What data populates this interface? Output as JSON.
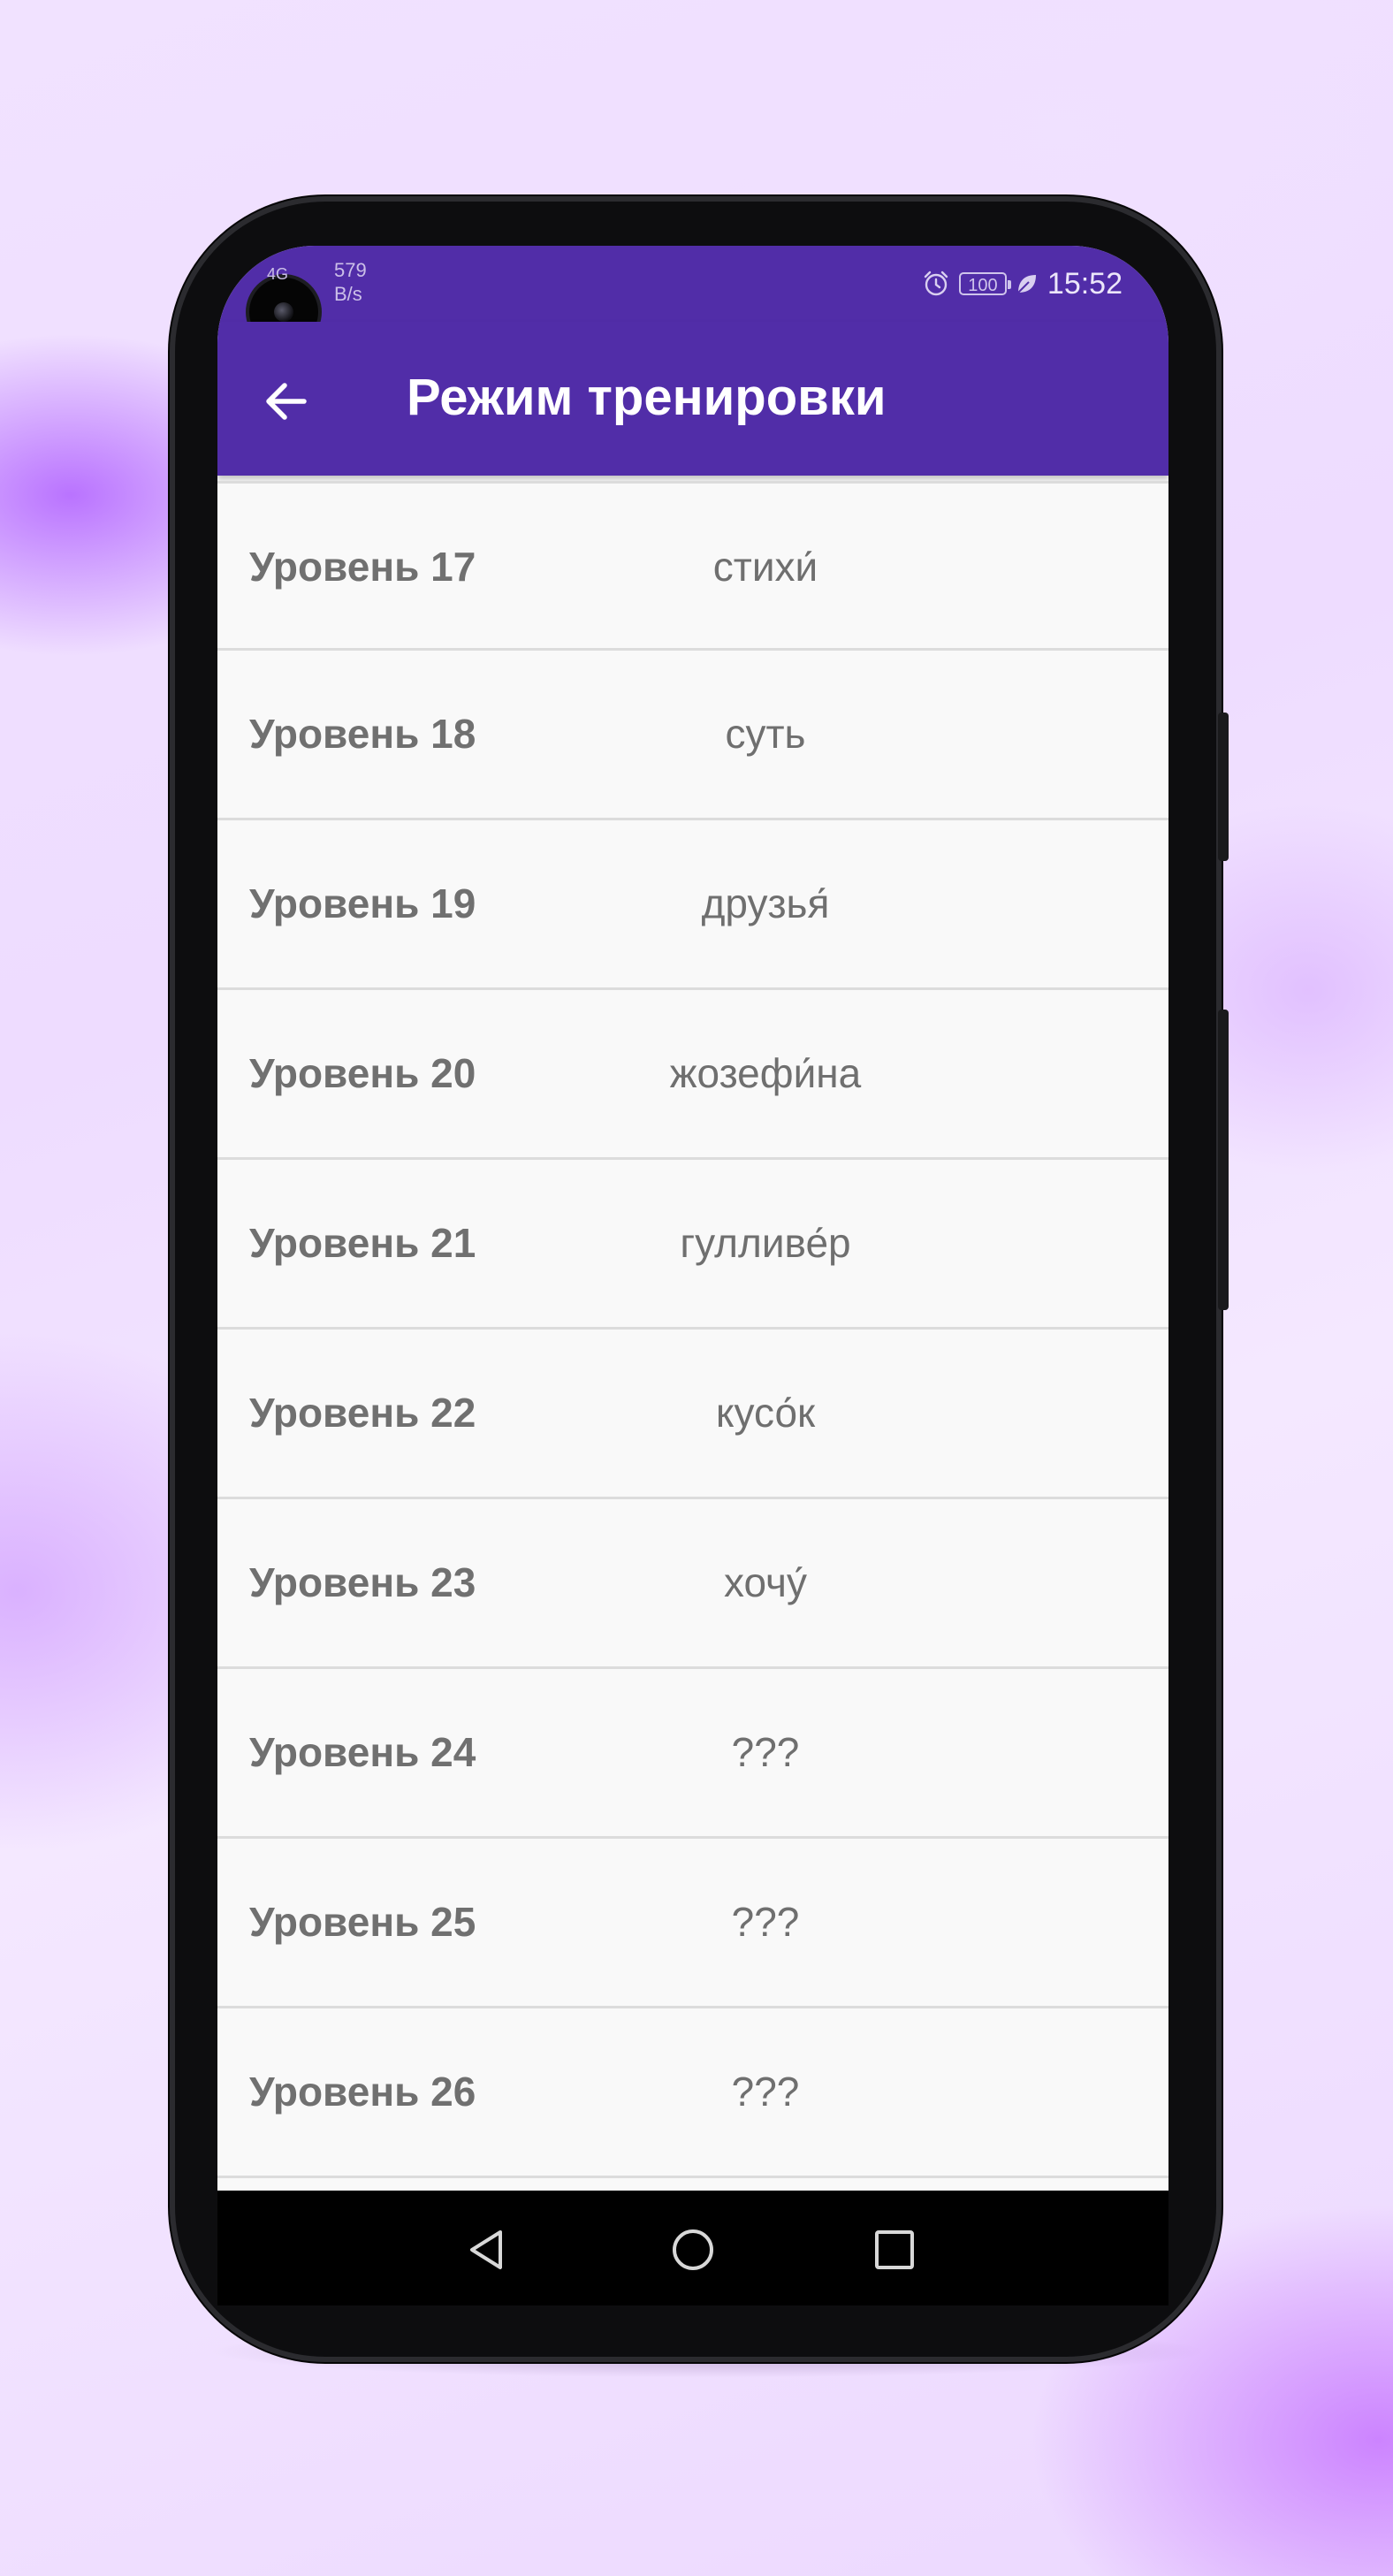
{
  "status_bar": {
    "network_type": "4G",
    "network_speed_value": "579",
    "network_speed_unit": "B/s",
    "battery": "100",
    "time": "15:52",
    "icons": [
      "signal-icon",
      "alarm-icon",
      "battery-icon",
      "leaf-icon"
    ]
  },
  "app_bar": {
    "title": "Режим тренировки",
    "back_icon": "arrow-left-icon"
  },
  "levels": [
    {
      "label": "Уровень 17",
      "word": "стихи́"
    },
    {
      "label": "Уровень 18",
      "word": "суть"
    },
    {
      "label": "Уровень 19",
      "word": "друзья́"
    },
    {
      "label": "Уровень 20",
      "word": "жозефи́на"
    },
    {
      "label": "Уровень 21",
      "word": "гулливе́р"
    },
    {
      "label": "Уровень 22",
      "word": "кусо́к"
    },
    {
      "label": "Уровень 23",
      "word": "хочу́"
    },
    {
      "label": "Уровень 24",
      "word": "???"
    },
    {
      "label": "Уровень 25",
      "word": "???"
    },
    {
      "label": "Уровень 26",
      "word": "???"
    }
  ],
  "nav_bar": {
    "icons": [
      "back-triangle-icon",
      "home-circle-icon",
      "recents-square-icon"
    ]
  },
  "colors": {
    "primary": "#512da8",
    "list_background": "#f9f9f9",
    "text": "#707070",
    "divider": "#dcdcdc"
  }
}
